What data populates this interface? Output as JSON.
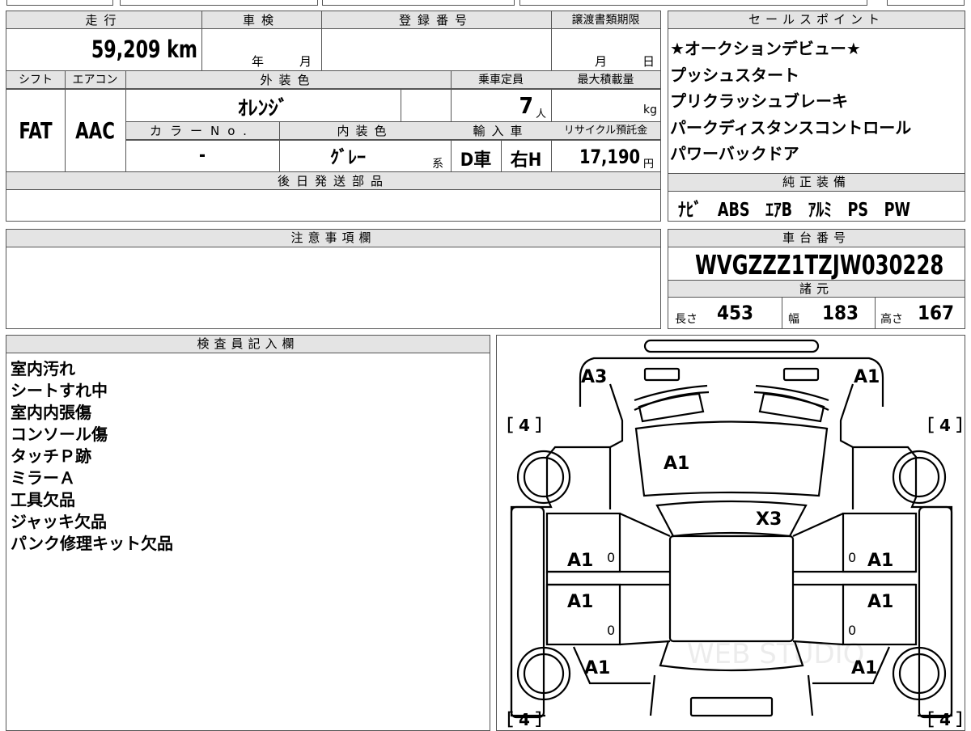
{
  "top_strip": {
    "fragment_a": "",
    "fragment_b": ""
  },
  "left_table": {
    "headers": {
      "mileage": "走行",
      "inspection": "車検",
      "registration": "登録番号",
      "transfer_deadline": "譲渡書類期限"
    },
    "mileage": "59,209 km",
    "inspection_year_label": "年",
    "inspection_month_label": "月",
    "transfer_month_label": "月",
    "transfer_day_label": "日",
    "headers2": {
      "shift": "シフト",
      "aircon": "エアコン",
      "exterior_color": "外装色",
      "capacity": "乗車定員",
      "max_load": "最大積載量"
    },
    "shift": "FAT",
    "aircon": "AAC",
    "exterior_color": "ｵﾚﾝｼﾞ",
    "capacity": "7",
    "capacity_unit": "人",
    "max_load_unit": "kg",
    "headers3": {
      "color_no": "カラーNo.",
      "interior_color": "内装色",
      "import": "輸入車",
      "recycle": "リサイクル預託金"
    },
    "color_no": "-",
    "interior_color": "ｸﾞﾚｰ",
    "interior_suffix": "系",
    "import_type": "D車",
    "steering": "右H",
    "recycle_fee": "17,190",
    "recycle_unit": "円",
    "later_parts_header": "後日発送部品",
    "later_parts": ""
  },
  "sales_points": {
    "header": "セールスポイント",
    "items": [
      "★オークションデビュー★",
      "プッシュスタート",
      "プリクラッシュブレーキ",
      "パークディスタンスコントロール",
      "パワーバックドア"
    ]
  },
  "genuine_equipment": {
    "header": "純正装備",
    "items": "ﾅﾋﾞ　ABS　ｴｱB　ｱﾙﾐ　PS　PW"
  },
  "notes": {
    "header": "注意事項欄",
    "text": ""
  },
  "vin": {
    "header": "車台番号",
    "value": "WVGZZZ1TZJW030228"
  },
  "specs": {
    "header": "諸元",
    "length_label": "長さ",
    "length": "453",
    "width_label": "幅",
    "width": "183",
    "height_label": "高さ",
    "height": "167"
  },
  "inspector": {
    "header": "検査員記入欄",
    "lines": [
      "室内汚れ",
      "シートすれ中",
      "室内内張傷",
      "コンソール傷",
      "タッチＰ跡",
      "ミラーＡ",
      "工具欠品",
      "ジャッキ欠品",
      "パンク修理キット欠品"
    ]
  },
  "diagram": {
    "marks": {
      "front_left": "A3",
      "front_right": "A1",
      "hood": "A1",
      "windshield": "X3",
      "left_front_door": "A1",
      "right_front_door": "A1",
      "left_rear_door": "A1",
      "right_rear_door": "A1",
      "left_rear_fender": "A1",
      "right_rear_fender": "A1"
    },
    "tire_front_left": "［ 4 ］",
    "tire_front_right": "［ 4 ］",
    "tire_rear_left": "［ 4 ］",
    "tire_rear_right": "［ 4 ］",
    "zero_mark": "0",
    "watermark": "WEB STUDIO"
  }
}
